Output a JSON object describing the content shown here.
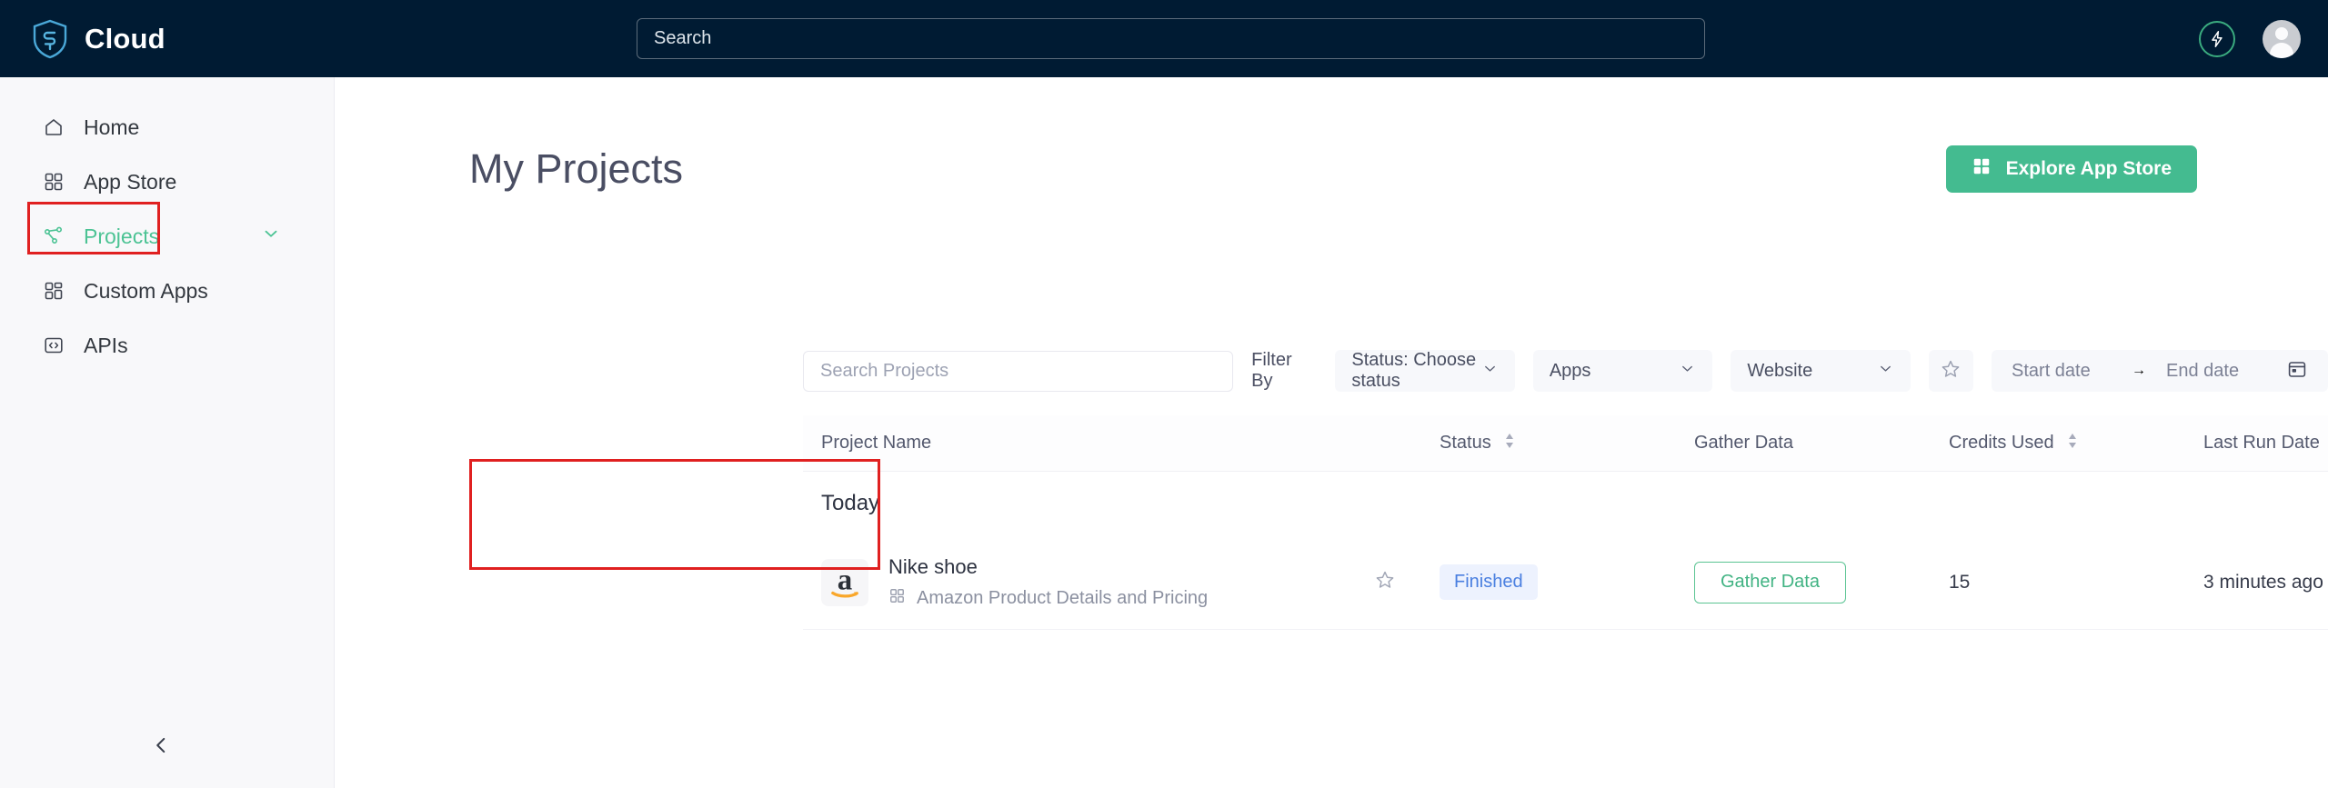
{
  "header": {
    "brand": "Cloud",
    "logo_icon": "shield-s-logo",
    "search_placeholder": "Search",
    "search_value": "",
    "bolt_icon": "lightning-bolt-icon",
    "avatar_icon": "user-avatar-icon",
    "accent_dark": "#001b33",
    "accent_green": "#3aab7f"
  },
  "sidebar": {
    "items": [
      {
        "label": "Home",
        "icon": "home-icon",
        "active": false
      },
      {
        "label": "App Store",
        "icon": "grid-icon",
        "active": false
      },
      {
        "label": "Projects",
        "icon": "sitemap-icon",
        "active": true
      },
      {
        "label": "Custom Apps",
        "icon": "layout-grid-icon",
        "active": false
      },
      {
        "label": "APIs",
        "icon": "code-icon",
        "active": false
      }
    ],
    "expand_chevron": "chevron-down-icon",
    "collapse_icon": "chevron-left-icon",
    "active_color": "#4cc394"
  },
  "main": {
    "title": "My Projects",
    "explore_button": "Explore App Store",
    "explore_icon": "grid-icon",
    "explore_color": "#44bb90"
  },
  "filters": {
    "search_placeholder": "Search Projects",
    "search_value": "",
    "filter_by_label": "Filter By",
    "status_select": "Status: Choose status",
    "apps_select": "Apps",
    "website_select": "Website",
    "chevron_icon": "chevron-down-icon",
    "favorite_icon": "star-outline-icon",
    "start_date_placeholder": "Start date",
    "start_date_value": "",
    "end_date_placeholder": "End date",
    "end_date_value": "",
    "date_separator": "→",
    "calendar_icon": "calendar-icon"
  },
  "table": {
    "columns": [
      {
        "label": "Project Name",
        "sortable": false
      },
      {
        "label": "",
        "sortable": false
      },
      {
        "label": "Status",
        "sortable": true
      },
      {
        "label": "Gather Data",
        "sortable": false
      },
      {
        "label": "Credits Used",
        "sortable": true
      },
      {
        "label": "Last Run Date",
        "sortable": true
      },
      {
        "label": "",
        "sortable": false
      }
    ],
    "groups": [
      {
        "label": "Today",
        "rows": [
          {
            "app_icon": "amazon-logo-icon",
            "project_name": "Nike shoe",
            "app_name": "Amazon Product Details and Pricing",
            "app_name_icon": "grid-icon",
            "favorite_icon": "star-outline-icon",
            "favorited": false,
            "status": "Finished",
            "status_color": "#4a7fe0",
            "gather_button": "Gather Data",
            "credits_used": "15",
            "last_run_date": "3 minutes ago",
            "menu_icon": "kebab-menu-icon"
          }
        ]
      }
    ]
  },
  "annotations": {
    "color": "#e02020",
    "boxes": [
      {
        "target": "sidebar-item-projects"
      },
      {
        "target": "project-row-nike-shoe"
      }
    ]
  }
}
